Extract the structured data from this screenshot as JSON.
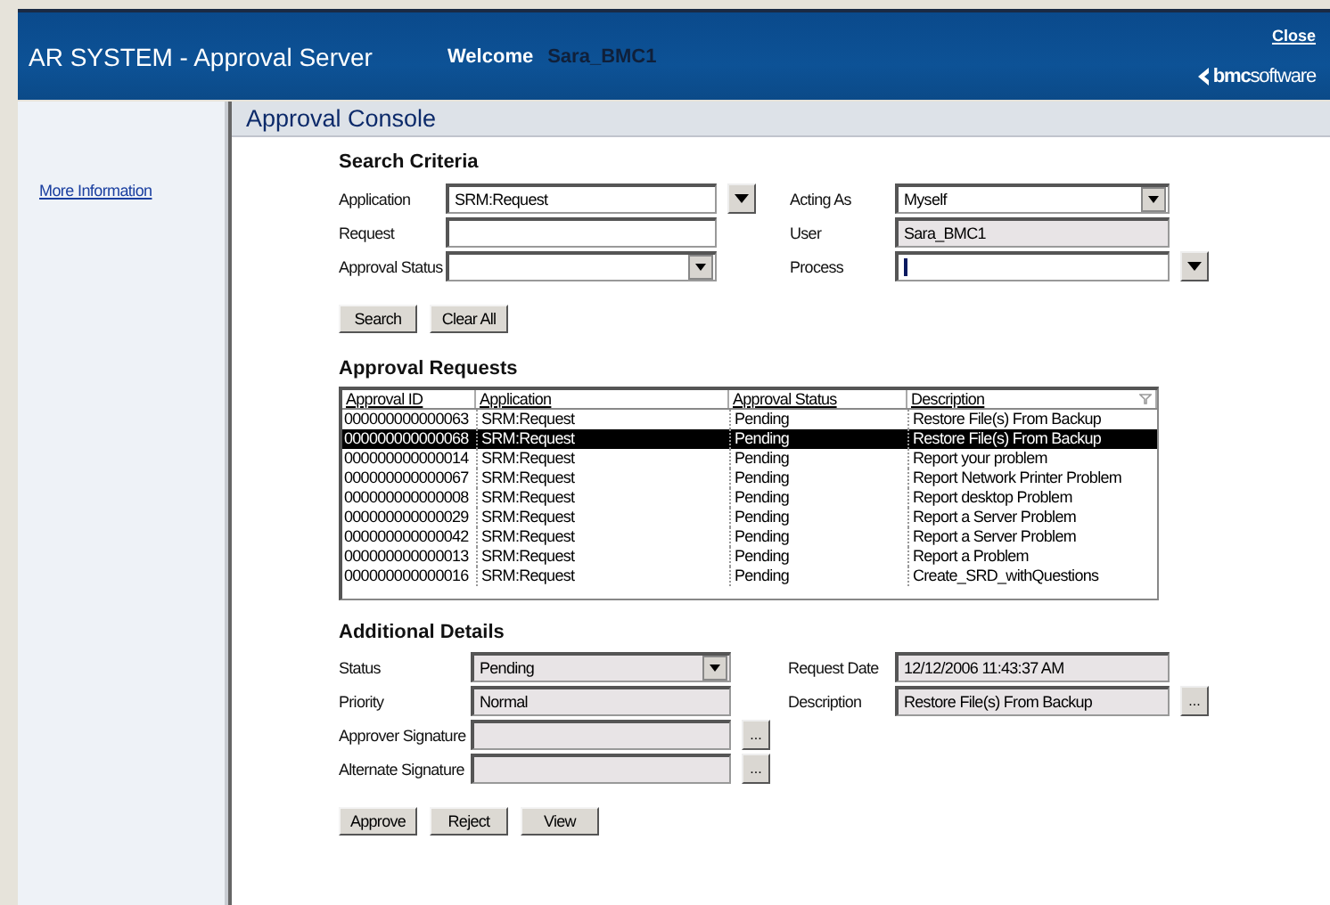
{
  "header": {
    "title": "AR SYSTEM - Approval Server",
    "welcome_label": "Welcome",
    "user": "Sara_BMC1",
    "close": "Close",
    "logo": "**bmc**software"
  },
  "sidebar": {
    "links": [
      "More Information"
    ]
  },
  "console": {
    "title": "Approval Console"
  },
  "search": {
    "heading": "Search Criteria",
    "rows": [
      [
        {
          "label": "Application",
          "kind": "combo",
          "value": "SRM:Request",
          "readonly": false
        },
        {
          "label": "Acting As",
          "kind": "select",
          "value": "Myself",
          "readonly": false
        }
      ],
      [
        {
          "label": "Request",
          "kind": "text",
          "readonly": false
        },
        {
          "label": "User",
          "kind": "text",
          "value": "Sara_BMC1",
          "readonly": true
        }
      ],
      [
        {
          "label": "Approval Status",
          "kind": "select",
          "readonly": false
        },
        {
          "label": "Process",
          "kind": "combo",
          "readonly": false,
          "focused": true
        }
      ]
    ],
    "buttons": [
      "Search",
      "Clear All"
    ]
  },
  "requests": {
    "heading": "Approval Requests",
    "columns": [
      "Approval ID",
      "Application",
      "Approval Status",
      "Description"
    ],
    "rows": [
      {
        "cells": [
          "000000000000063",
          "SRM:Request",
          "Pending",
          "Restore File(s) From Backup"
        ],
        "selected": false
      },
      {
        "cells": [
          "000000000000068",
          "SRM:Request",
          "Pending",
          "Restore File(s) From Backup"
        ],
        "selected": true
      },
      {
        "cells": [
          "000000000000014",
          "SRM:Request",
          "Pending",
          "Report your problem"
        ],
        "selected": false
      },
      {
        "cells": [
          "000000000000067",
          "SRM:Request",
          "Pending",
          "Report Network Printer Problem"
        ],
        "selected": false
      },
      {
        "cells": [
          "000000000000008",
          "SRM:Request",
          "Pending",
          "Report desktop Problem"
        ],
        "selected": false
      },
      {
        "cells": [
          "000000000000029",
          "SRM:Request",
          "Pending",
          "Report a Server Problem"
        ],
        "selected": false
      },
      {
        "cells": [
          "000000000000042",
          "SRM:Request",
          "Pending",
          "Report a Server Problem"
        ],
        "selected": false
      },
      {
        "cells": [
          "000000000000013",
          "SRM:Request",
          "Pending",
          "Report a Problem"
        ],
        "selected": false
      },
      {
        "cells": [
          "000000000000016",
          "SRM:Request",
          "Pending",
          "Create_SRD_withQuestions"
        ],
        "selected": false
      }
    ]
  },
  "details": {
    "heading": "Additional Details",
    "rows": [
      [
        {
          "label": "Status",
          "kind": "select",
          "value": "Pending",
          "readonly": true
        },
        {
          "label": "Request Date",
          "kind": "text",
          "value": "12/12/2006 11:43:37 AM",
          "readonly": true
        }
      ],
      [
        {
          "label": "Priority",
          "kind": "text",
          "value": "Normal",
          "readonly": true
        },
        {
          "label": "Description",
          "kind": "ellipsis",
          "value": "Restore File(s) From Backup",
          "readonly": true,
          "button": "..."
        }
      ],
      [
        {
          "label": "Approver Signature",
          "kind": "ellipsis",
          "readonly": true,
          "button": "..."
        }
      ],
      [
        {
          "label": "Alternate Signature",
          "kind": "ellipsis",
          "readonly": true,
          "button": "..."
        }
      ]
    ],
    "buttons": [
      "Approve",
      "Reject",
      "View"
    ]
  }
}
